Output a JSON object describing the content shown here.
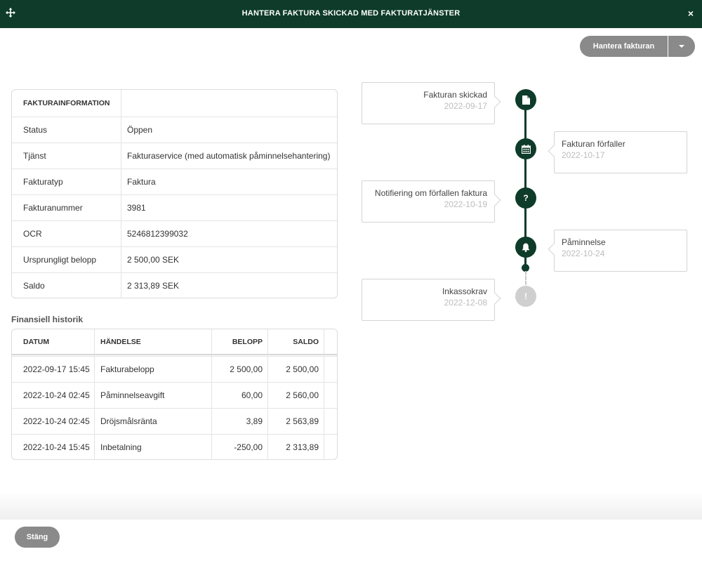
{
  "window": {
    "title": "HANTERA FAKTURA SKICKAD MED FAKTURATJÄNSTER",
    "close_symbol": "×"
  },
  "actions": {
    "manage_label": "Hantera fakturan"
  },
  "invoice_info": {
    "header": "FAKTURAINFORMATION",
    "rows": [
      {
        "key": "Status",
        "value": "Öppen"
      },
      {
        "key": "Tjänst",
        "value": "Fakturaservice (med automatisk påminnelsehantering)"
      },
      {
        "key": "Fakturatyp",
        "value": "Faktura"
      },
      {
        "key": "Fakturanummer",
        "value": "3981"
      },
      {
        "key": "OCR",
        "value": "5246812399032"
      },
      {
        "key": "Ursprungligt belopp",
        "value": "2 500,00 SEK"
      },
      {
        "key": "Saldo",
        "value": "2 313,89 SEK"
      }
    ]
  },
  "history": {
    "title": "Finansiell historik",
    "columns": {
      "date": "DATUM",
      "event": "HÄNDELSE",
      "amount": "BELOPP",
      "balance": "SALDO"
    },
    "rows": [
      {
        "date": "2022-09-17 15:45",
        "event": "Fakturabelopp",
        "amount": "2 500,00",
        "balance": "2 500,00"
      },
      {
        "date": "2022-10-24 02:45",
        "event": "Påminnelseavgift",
        "amount": "60,00",
        "balance": "2 560,00"
      },
      {
        "date": "2022-10-24 02:45",
        "event": "Dröjsmålsränta",
        "amount": "3,89",
        "balance": "2 563,89"
      },
      {
        "date": "2022-10-24 15:45",
        "event": "Inbetalning",
        "amount": "-250,00",
        "balance": "2 313,89"
      }
    ]
  },
  "timeline": {
    "events": [
      {
        "title": "Fakturan skickad",
        "date": "2022-09-17",
        "icon": "document-icon",
        "side": "left",
        "done": true
      },
      {
        "title": "Fakturan förfaller",
        "date": "2022-10-17",
        "icon": "calendar-icon",
        "side": "right",
        "done": true
      },
      {
        "title": "Notifiering om förfallen faktura",
        "date": "2022-10-19",
        "icon": "question-icon",
        "side": "left",
        "done": true,
        "glyph": "?"
      },
      {
        "title": "Påminnelse",
        "date": "2022-10-24",
        "icon": "bell-icon",
        "side": "right",
        "done": true
      },
      {
        "title": "Inkassokrav",
        "date": "2022-12-08",
        "icon": "exclamation-icon",
        "side": "left",
        "done": false,
        "glyph": "!"
      }
    ]
  },
  "footer": {
    "close_label": "Stäng"
  },
  "colors": {
    "brand": "#0e3b2a",
    "button_gray": "#8a8a8a",
    "muted_node": "#cfcfcf"
  }
}
